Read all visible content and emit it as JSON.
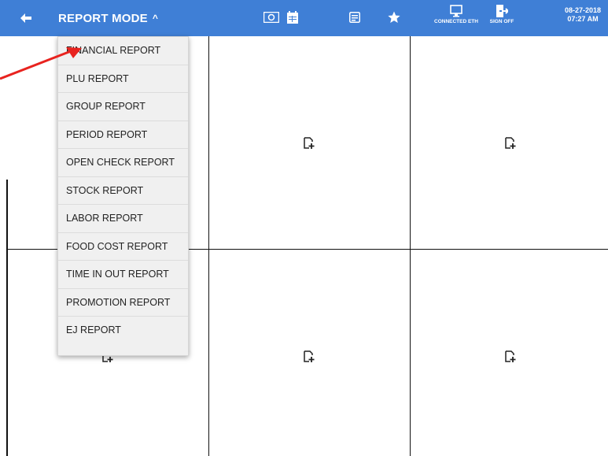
{
  "colors": {
    "topbar": "#3f7fd6",
    "arrow": "#e8231f",
    "menu_bg": "#f0f0f0"
  },
  "topbar": {
    "back_icon": "arrow-left-icon",
    "mode_label": "REPORT MODE",
    "mode_chevron": "^",
    "icons": [
      "cash-icon",
      "calendar-icon",
      "receipt-icon",
      "star-icon"
    ],
    "connected_label": "CONNECTED ETH",
    "signoff_label": "SIGN OFF",
    "date": "08-27-2018",
    "time": "07:27 AM"
  },
  "menu": {
    "items": [
      {
        "label": "FINANCIAL REPORT"
      },
      {
        "label": "PLU REPORT"
      },
      {
        "label": "GROUP REPORT"
      },
      {
        "label": "PERIOD REPORT"
      },
      {
        "label": "OPEN CHECK REPORT"
      },
      {
        "label": "STOCK REPORT"
      },
      {
        "label": "LABOR REPORT"
      },
      {
        "label": "FOOD COST REPORT"
      },
      {
        "label": "TIME IN OUT REPORT"
      },
      {
        "label": "PROMOTION REPORT"
      },
      {
        "label": "EJ REPORT"
      }
    ]
  },
  "slots": {
    "add_icon": "add-document-icon",
    "count": 6
  }
}
